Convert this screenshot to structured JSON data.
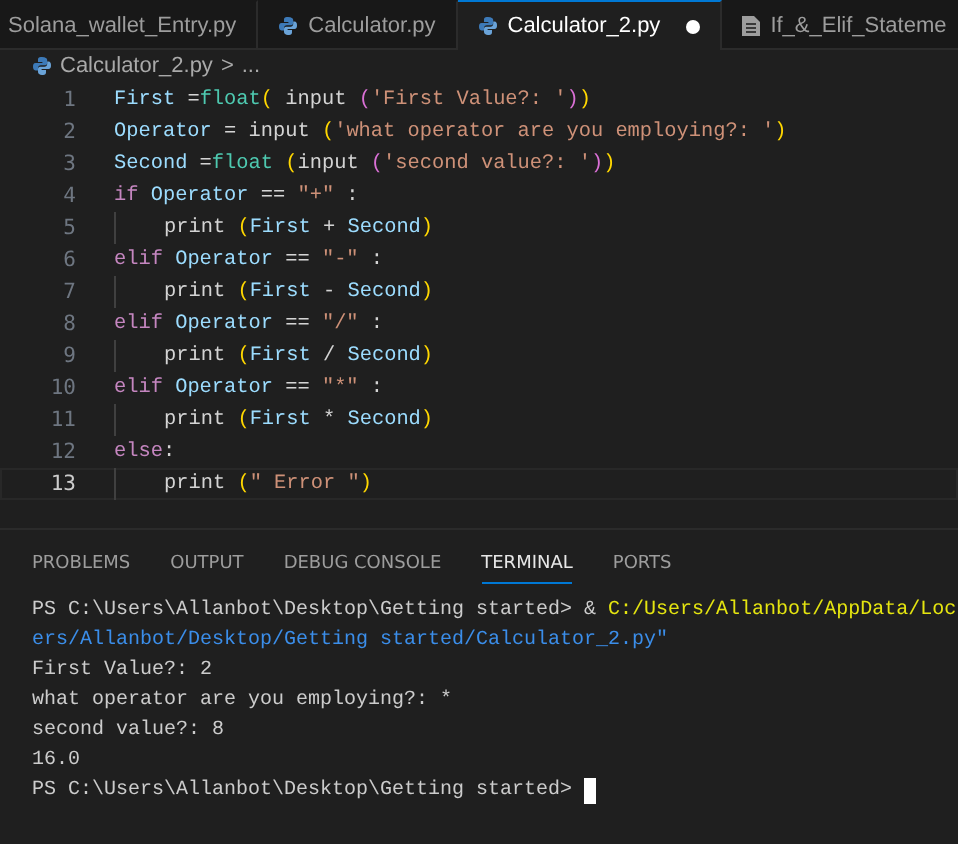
{
  "tabs": [
    {
      "label": "Solana_wallet_Entry.py",
      "kind": "plain",
      "selected": false,
      "modified": false
    },
    {
      "label": "Calculator.py",
      "kind": "python",
      "selected": false,
      "modified": false
    },
    {
      "label": "Calculator_2.py",
      "kind": "python",
      "selected": true,
      "modified": true
    },
    {
      "label": "If_&_Elif_Stateme",
      "kind": "text",
      "selected": false,
      "modified": false
    }
  ],
  "breadcrumb": {
    "file": "Calculator_2.py",
    "separator": ">",
    "more": "..."
  },
  "editor": {
    "lines": [
      {
        "number": "1",
        "current": false,
        "guide": false,
        "tokens": [
          {
            "t": "First ",
            "kind": "var"
          },
          {
            "t": "=",
            "kind": "plain"
          },
          {
            "t": "float",
            "kind": "func"
          },
          {
            "t": "(",
            "kind": "paren1"
          },
          {
            "t": " input ",
            "kind": "plain"
          },
          {
            "t": "(",
            "kind": "paren2"
          },
          {
            "t": "'First Value?: '",
            "kind": "string"
          },
          {
            "t": ")",
            "kind": "paren2"
          },
          {
            "t": ")",
            "kind": "paren1"
          }
        ]
      },
      {
        "number": "2",
        "current": false,
        "guide": false,
        "tokens": [
          {
            "t": "Operator ",
            "kind": "var"
          },
          {
            "t": "= input ",
            "kind": "plain"
          },
          {
            "t": "(",
            "kind": "paren1"
          },
          {
            "t": "'what operator are you employing?: '",
            "kind": "string"
          },
          {
            "t": ")",
            "kind": "paren1"
          }
        ]
      },
      {
        "number": "3",
        "current": false,
        "guide": false,
        "tokens": [
          {
            "t": "Second ",
            "kind": "var"
          },
          {
            "t": "=",
            "kind": "plain"
          },
          {
            "t": "float ",
            "kind": "func"
          },
          {
            "t": "(",
            "kind": "paren1"
          },
          {
            "t": "input ",
            "kind": "plain"
          },
          {
            "t": "(",
            "kind": "paren2"
          },
          {
            "t": "'second value?: '",
            "kind": "string"
          },
          {
            "t": ")",
            "kind": "paren2"
          },
          {
            "t": ")",
            "kind": "paren1"
          }
        ]
      },
      {
        "number": "4",
        "current": false,
        "guide": false,
        "tokens": [
          {
            "t": "if ",
            "kind": "keyword"
          },
          {
            "t": "Operator ",
            "kind": "var"
          },
          {
            "t": "== ",
            "kind": "plain"
          },
          {
            "t": "\"+\"",
            "kind": "string"
          },
          {
            "t": " :",
            "kind": "plain"
          }
        ]
      },
      {
        "number": "5",
        "current": false,
        "guide": true,
        "tokens": [
          {
            "t": "print ",
            "kind": "plain"
          },
          {
            "t": "(",
            "kind": "paren1"
          },
          {
            "t": "First ",
            "kind": "var"
          },
          {
            "t": "+ ",
            "kind": "plain"
          },
          {
            "t": "Second",
            "kind": "var"
          },
          {
            "t": ")",
            "kind": "paren1"
          }
        ]
      },
      {
        "number": "6",
        "current": false,
        "guide": false,
        "tokens": [
          {
            "t": "elif ",
            "kind": "keyword"
          },
          {
            "t": "Operator ",
            "kind": "var"
          },
          {
            "t": "== ",
            "kind": "plain"
          },
          {
            "t": "\"-\"",
            "kind": "string"
          },
          {
            "t": " :",
            "kind": "plain"
          }
        ]
      },
      {
        "number": "7",
        "current": false,
        "guide": true,
        "tokens": [
          {
            "t": "print ",
            "kind": "plain"
          },
          {
            "t": "(",
            "kind": "paren1"
          },
          {
            "t": "First ",
            "kind": "var"
          },
          {
            "t": "- ",
            "kind": "plain"
          },
          {
            "t": "Second",
            "kind": "var"
          },
          {
            "t": ")",
            "kind": "paren1"
          }
        ]
      },
      {
        "number": "8",
        "current": false,
        "guide": false,
        "tokens": [
          {
            "t": "elif ",
            "kind": "keyword"
          },
          {
            "t": "Operator ",
            "kind": "var"
          },
          {
            "t": "== ",
            "kind": "plain"
          },
          {
            "t": "\"/\"",
            "kind": "string"
          },
          {
            "t": " :",
            "kind": "plain"
          }
        ]
      },
      {
        "number": "9",
        "current": false,
        "guide": true,
        "tokens": [
          {
            "t": "print ",
            "kind": "plain"
          },
          {
            "t": "(",
            "kind": "paren1"
          },
          {
            "t": "First ",
            "kind": "var"
          },
          {
            "t": "/ ",
            "kind": "plain"
          },
          {
            "t": "Second",
            "kind": "var"
          },
          {
            "t": ")",
            "kind": "paren1"
          }
        ]
      },
      {
        "number": "10",
        "current": false,
        "guide": false,
        "tokens": [
          {
            "t": "elif ",
            "kind": "keyword"
          },
          {
            "t": "Operator ",
            "kind": "var"
          },
          {
            "t": "== ",
            "kind": "plain"
          },
          {
            "t": "\"*\"",
            "kind": "string"
          },
          {
            "t": " :",
            "kind": "plain"
          }
        ]
      },
      {
        "number": "11",
        "current": false,
        "guide": true,
        "tokens": [
          {
            "t": "print ",
            "kind": "plain"
          },
          {
            "t": "(",
            "kind": "paren1"
          },
          {
            "t": "First ",
            "kind": "var"
          },
          {
            "t": "* ",
            "kind": "plain"
          },
          {
            "t": "Second",
            "kind": "var"
          },
          {
            "t": ")",
            "kind": "paren1"
          }
        ]
      },
      {
        "number": "12",
        "current": false,
        "guide": false,
        "tokens": [
          {
            "t": "else",
            "kind": "keyword"
          },
          {
            "t": ":",
            "kind": "plain"
          }
        ]
      },
      {
        "number": "13",
        "current": true,
        "guide": true,
        "tokens": [
          {
            "t": "print ",
            "kind": "plain"
          },
          {
            "t": "(",
            "kind": "paren1"
          },
          {
            "t": "\" Error \"",
            "kind": "string"
          },
          {
            "t": ")",
            "kind": "paren1"
          }
        ]
      }
    ]
  },
  "panel_tabs": [
    {
      "label": "PROBLEMS",
      "selected": false
    },
    {
      "label": "OUTPUT",
      "selected": false
    },
    {
      "label": "DEBUG CONSOLE",
      "selected": false
    },
    {
      "label": "TERMINAL",
      "selected": true
    },
    {
      "label": "PORTS",
      "selected": false
    }
  ],
  "terminal": {
    "lines": [
      {
        "segments": [
          {
            "t": "PS C:\\Users\\Allanbot\\Desktop\\Getting started> & ",
            "kind": "plain"
          },
          {
            "t": "C:/Users/Allanbot/AppData/Loc",
            "kind": "path"
          }
        ]
      },
      {
        "segments": [
          {
            "t": "ers/Allanbot/Desktop/Getting started/Calculator_2.py\"",
            "kind": "arg"
          }
        ]
      },
      {
        "segments": [
          {
            "t": "First Value?: 2",
            "kind": "plain"
          }
        ]
      },
      {
        "segments": [
          {
            "t": "what operator are you employing?: *",
            "kind": "plain"
          }
        ]
      },
      {
        "segments": [
          {
            "t": "second value?: 8",
            "kind": "plain"
          }
        ]
      },
      {
        "segments": [
          {
            "t": "16.0",
            "kind": "plain"
          }
        ]
      },
      {
        "segments": [
          {
            "t": "PS C:\\Users\\Allanbot\\Desktop\\Getting started>",
            "kind": "plain"
          }
        ],
        "cursor": true
      }
    ]
  }
}
